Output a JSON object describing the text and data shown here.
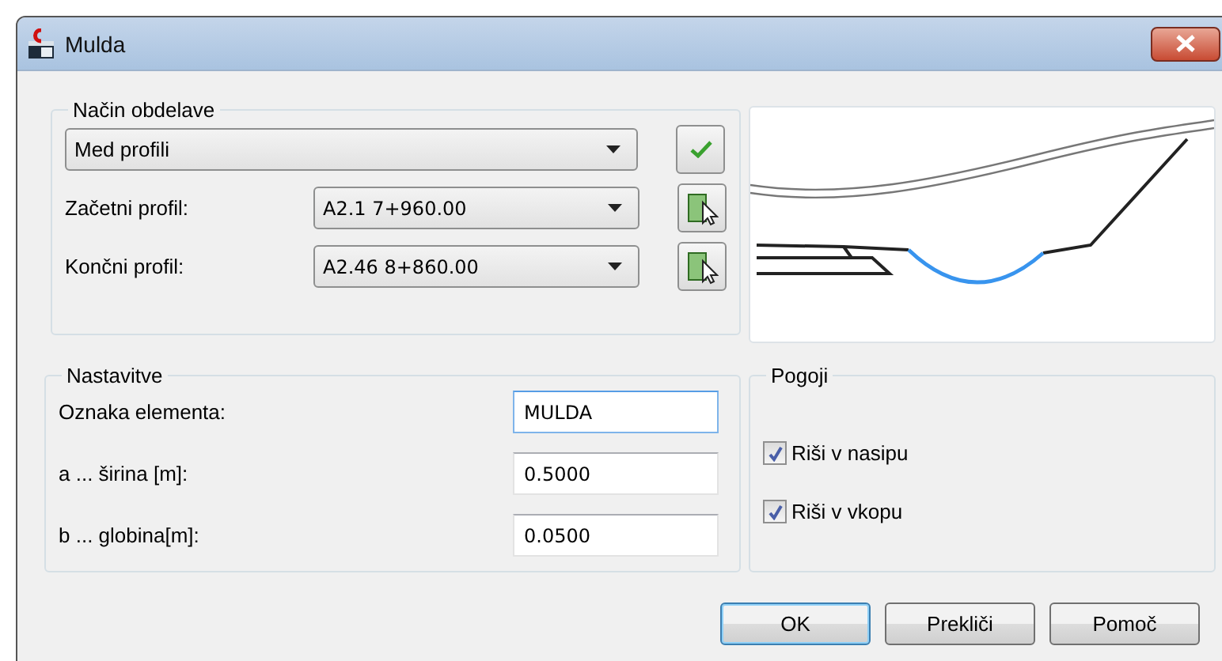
{
  "window": {
    "title": "Mulda"
  },
  "processing": {
    "legend": "Način obdelave",
    "method": {
      "value": "Med profili"
    },
    "profiles": [
      {
        "label": "Začetni profil:",
        "value": "A2.1 7+960.00"
      },
      {
        "label": "Končni profil:",
        "value": "A2.46 8+860.00"
      }
    ]
  },
  "settings": {
    "legend": "Nastavitve",
    "fields": [
      {
        "label": "Oznaka elementa:",
        "value": "MULDA",
        "focused": true
      },
      {
        "label": "a ... širina [m]:",
        "value": "0.5000",
        "focused": false
      },
      {
        "label": "b ... globina[m]:",
        "value": "0.0500",
        "focused": false
      }
    ]
  },
  "conditions": {
    "legend": "Pogoji",
    "options": [
      {
        "label": "Riši v nasipu",
        "checked": true
      },
      {
        "label": "Riši v vkopu",
        "checked": true
      }
    ]
  },
  "buttons": [
    {
      "label": "OK",
      "default": true
    },
    {
      "label": "Prekliči",
      "default": false
    },
    {
      "label": "Pomoč",
      "default": false
    }
  ]
}
